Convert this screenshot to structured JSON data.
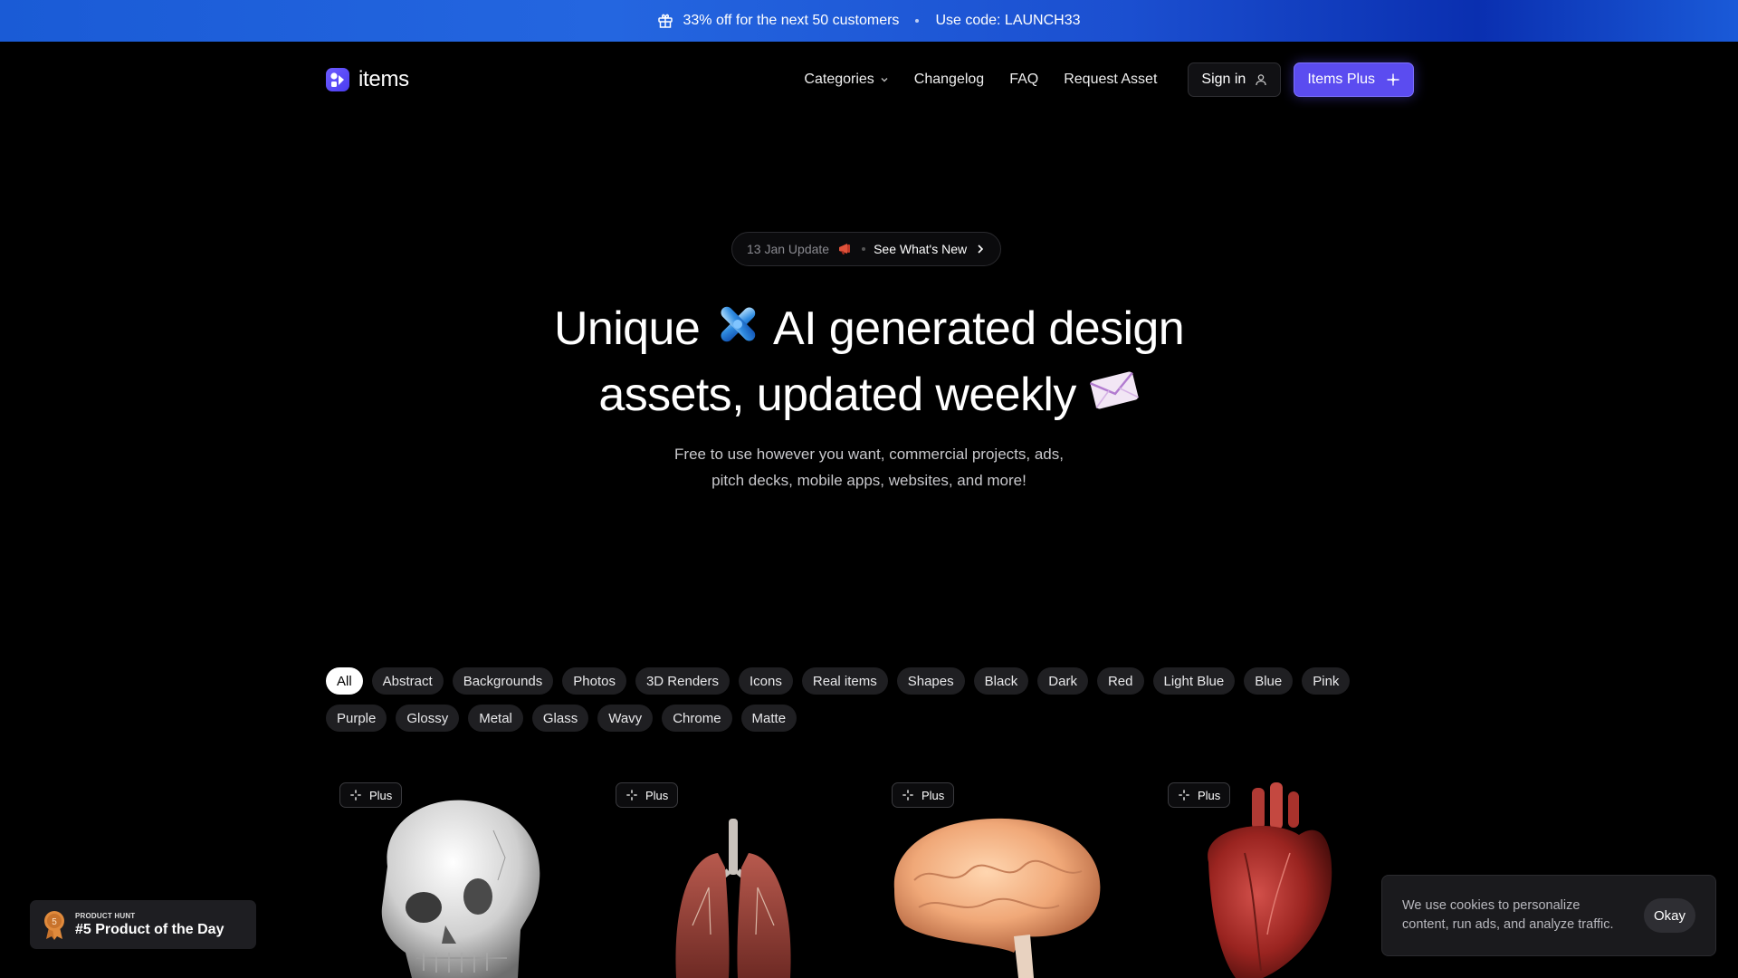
{
  "promo": {
    "text": "33% off for the next 50 customers",
    "code": "Use code: LAUNCH33",
    "icon": "gift-icon"
  },
  "nav": {
    "logo_text": "items",
    "links": [
      "Categories",
      "Changelog",
      "FAQ",
      "Request Asset"
    ],
    "signin_label": "Sign in",
    "plus_label": "Items Plus"
  },
  "update": {
    "date": "13 Jan Update",
    "cta": "See What's New"
  },
  "hero": {
    "line1_a": "Unique",
    "line1_b": "AI generated design",
    "line2": "assets, updated weekly",
    "sub1": "Free to use however you want, commercial projects, ads,",
    "sub2": "pitch decks, mobile apps, websites, and more!"
  },
  "filters": [
    "All",
    "Abstract",
    "Backgrounds",
    "Photos",
    "3D Renders",
    "Icons",
    "Real items",
    "Shapes",
    "Black",
    "Dark",
    "Red",
    "Light Blue",
    "Blue",
    "Pink",
    "Purple",
    "Glossy",
    "Metal",
    "Glass",
    "Wavy",
    "Chrome",
    "Matte"
  ],
  "active_filter": "All",
  "cards": [
    {
      "badge": "Plus",
      "subject": "skull"
    },
    {
      "badge": "Plus",
      "subject": "lungs"
    },
    {
      "badge": "Plus",
      "subject": "brain"
    },
    {
      "badge": "Plus",
      "subject": "heart"
    }
  ],
  "product_hunt": {
    "label": "PRODUCT HUNT",
    "title": "#5 Product of the Day",
    "rank": "5"
  },
  "cookie": {
    "text": "We use cookies to personalize content, run ads, and analyze traffic.",
    "button": "Okay"
  },
  "colors": {
    "accent": "#5b4cf0",
    "banner": "#1a5bd6",
    "background": "#000000"
  }
}
